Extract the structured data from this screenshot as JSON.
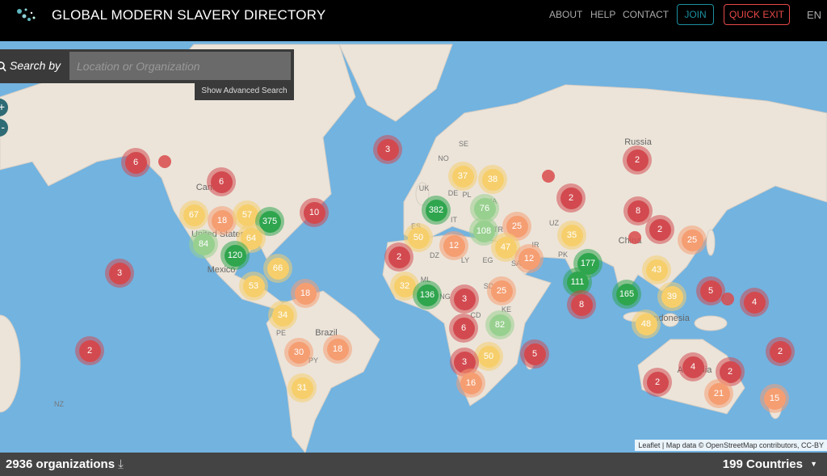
{
  "header": {
    "title": "GLOBAL MODERN SLAVERY DIRECTORY",
    "nav": [
      "ABOUT",
      "HELP",
      "CONTACT"
    ],
    "join": "JOIN",
    "quick_exit": "QUICK EXIT",
    "language": "EN"
  },
  "colors": {
    "join": "#1c8fa0",
    "quick_exit": "#e84848",
    "red": "#d24a4f",
    "orange": "#f59e72",
    "yellow": "#f6cf6c",
    "lightgreen": "#98d08f",
    "green": "#2fa54e"
  },
  "search": {
    "label": "Search by",
    "placeholder": "Location or Organization",
    "advanced": "Show Advanced Search"
  },
  "zoom": {
    "in": "+",
    "out": "-"
  },
  "map_labels": [
    "Russia",
    "Canada",
    "United States",
    "Mexico",
    "Brazil",
    "China",
    "Indonesia",
    "Australia",
    "NZ",
    "NO",
    "SE",
    "UK",
    "DE",
    "PL",
    "IT",
    "ES",
    "FR",
    "UA",
    "TR",
    "DZ",
    "LY",
    "EG",
    "SA",
    "IR",
    "UZ",
    "PK",
    "ML",
    "NG",
    "SD",
    "CD",
    "KE",
    "PE",
    "PY"
  ],
  "markers": [
    [
      "6",
      "red"
    ],
    [
      "6",
      "red"
    ],
    [
      "3",
      "red"
    ],
    [
      "10",
      "red"
    ],
    [
      "67",
      "yellow"
    ],
    [
      "18",
      "orange"
    ],
    [
      "57",
      "yellow"
    ],
    [
      "375",
      "green"
    ],
    [
      "84",
      "lightgreen"
    ],
    [
      "64",
      "yellow"
    ],
    [
      "120",
      "green"
    ],
    [
      "66",
      "yellow"
    ],
    [
      "3",
      "red"
    ],
    [
      "53",
      "yellow"
    ],
    [
      "18",
      "orange"
    ],
    [
      "34",
      "yellow"
    ],
    [
      "30",
      "orange"
    ],
    [
      "18",
      "orange"
    ],
    [
      "31",
      "yellow"
    ],
    [
      "2",
      "red"
    ],
    [
      "382",
      "green"
    ],
    [
      "37",
      "yellow"
    ],
    [
      "38",
      "yellow"
    ],
    [
      "76",
      "lightgreen"
    ],
    [
      "108",
      "lightgreen"
    ],
    [
      "25",
      "orange"
    ],
    [
      "50",
      "yellow"
    ],
    [
      "12",
      "orange"
    ],
    [
      "2",
      "red"
    ],
    [
      "47",
      "yellow"
    ],
    [
      "12",
      "orange"
    ],
    [
      "32",
      "yellow"
    ],
    [
      "136",
      "green"
    ],
    [
      "3",
      "red"
    ],
    [
      "25",
      "orange"
    ],
    [
      "6",
      "red"
    ],
    [
      "82",
      "lightgreen"
    ],
    [
      "50",
      "yellow"
    ],
    [
      "3",
      "red"
    ],
    [
      "16",
      "orange"
    ],
    [
      "5",
      "red"
    ],
    [
      "2",
      "red"
    ],
    [
      "2",
      "red"
    ],
    [
      "8",
      "red"
    ],
    [
      "2",
      "red"
    ],
    [
      "25",
      "orange"
    ],
    [
      "35",
      "yellow"
    ],
    [
      "177",
      "green"
    ],
    [
      "111",
      "green"
    ],
    [
      "43",
      "yellow"
    ],
    [
      "165",
      "green"
    ],
    [
      "8",
      "red"
    ],
    [
      "39",
      "yellow"
    ],
    [
      "5",
      "red"
    ],
    [
      "4",
      "red"
    ],
    [
      "48",
      "yellow"
    ],
    [
      "2",
      "red"
    ],
    [
      "4",
      "red"
    ],
    [
      "2",
      "red"
    ],
    [
      "2",
      "red"
    ],
    [
      "21",
      "orange"
    ],
    [
      "15",
      "orange"
    ]
  ],
  "attribution": "Leaflet | Map data © OpenStreetMap contributors, CC-BY",
  "footer": {
    "organizations": "2936 organizations",
    "countries": "199 Countries"
  }
}
